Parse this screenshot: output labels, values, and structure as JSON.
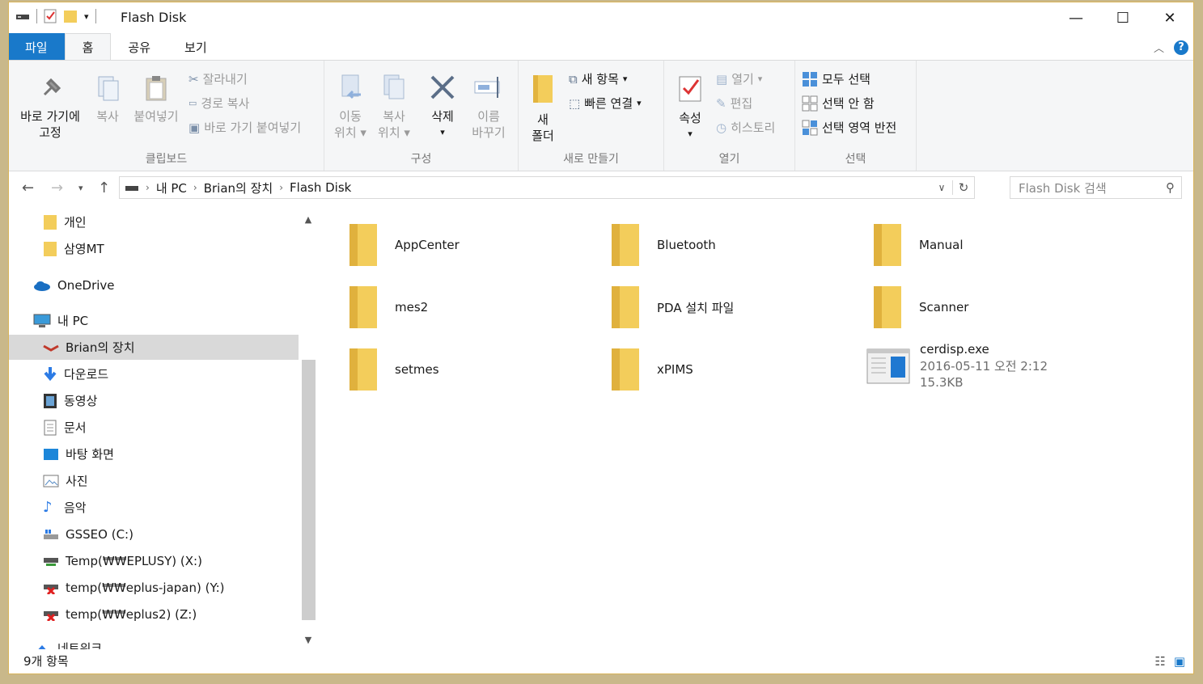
{
  "window": {
    "title": "Flash Disk",
    "controls": [
      "minimize",
      "maximize",
      "close"
    ]
  },
  "ribbon_tabs": [
    "파일",
    "홈",
    "공유",
    "보기"
  ],
  "ribbon": {
    "clipboard": {
      "label": "클립보드",
      "pin_line1": "바로 가기에",
      "pin_line2": "고정",
      "copy": "복사",
      "paste": "붙여넣기",
      "cut": "잘라내기",
      "copy_path": "경로 복사",
      "paste_shortcut": "바로 가기 붙여넣기"
    },
    "organize": {
      "label": "구성",
      "move_line1": "이동",
      "move_line2": "위치",
      "copyto_line1": "복사",
      "copyto_line2": "위치",
      "delete": "삭제",
      "rename_line1": "이름",
      "rename_line2": "바꾸기"
    },
    "new": {
      "label": "새로 만들기",
      "folder_line1": "새",
      "folder_line2": "폴더",
      "new_item": "새 항목",
      "easy_access": "빠른 연결"
    },
    "open": {
      "label": "열기",
      "properties": "속성",
      "open": "열기",
      "edit": "편집",
      "history": "히스토리"
    },
    "select": {
      "label": "선택",
      "select_all": "모두 선택",
      "select_none": "선택 안 함",
      "invert": "선택 영역 반전"
    }
  },
  "address": {
    "crumbs": [
      "내 PC",
      "Brian의 장치",
      "Flash Disk"
    ],
    "search_placeholder": "Flash Disk 검색"
  },
  "sidebar": {
    "items": [
      {
        "label": "개인",
        "icon": "folder-icon"
      },
      {
        "label": "삼영MT",
        "icon": "folder-icon"
      },
      {
        "label": "OneDrive",
        "icon": "cloud-icon"
      },
      {
        "label": "내 PC",
        "icon": "computer-icon"
      },
      {
        "label": "Brian의 장치",
        "icon": "device-icon"
      },
      {
        "label": "다운로드",
        "icon": "download-icon"
      },
      {
        "label": "동영상",
        "icon": "video-icon"
      },
      {
        "label": "문서",
        "icon": "document-icon"
      },
      {
        "label": "바탕 화면",
        "icon": "desktop-icon"
      },
      {
        "label": "사진",
        "icon": "picture-icon"
      },
      {
        "label": "음악",
        "icon": "music-icon"
      },
      {
        "label": "GSSEO (C:)",
        "icon": "drive-icon"
      },
      {
        "label": "Temp(₩₩EPLUSY) (X:)",
        "icon": "network-drive-icon"
      },
      {
        "label": "temp(₩₩eplus-japan) (Y:)",
        "icon": "disconnected-drive-icon"
      },
      {
        "label": "temp(₩₩eplus2) (Z:)",
        "icon": "disconnected-drive-icon"
      },
      {
        "label": "네트워크",
        "icon": "network-icon"
      }
    ],
    "selected": "Brian의 장치"
  },
  "content": {
    "items": [
      {
        "name": "AppCenter",
        "type": "folder"
      },
      {
        "name": "Bluetooth",
        "type": "folder"
      },
      {
        "name": "Manual",
        "type": "folder"
      },
      {
        "name": "mes2",
        "type": "folder"
      },
      {
        "name": "PDA 설치 파일",
        "type": "folder"
      },
      {
        "name": "Scanner",
        "type": "folder"
      },
      {
        "name": "setmes",
        "type": "folder"
      },
      {
        "name": "xPIMS",
        "type": "folder"
      },
      {
        "name": "cerdisp.exe",
        "type": "exe",
        "date": "2016-05-11 오전 2:12",
        "size": "15.3KB"
      }
    ]
  },
  "status": {
    "count": "9개 항목"
  },
  "colors": {
    "accent": "#1979ca",
    "folder": "#f3cd5b",
    "selection": "#d9d9d9"
  }
}
